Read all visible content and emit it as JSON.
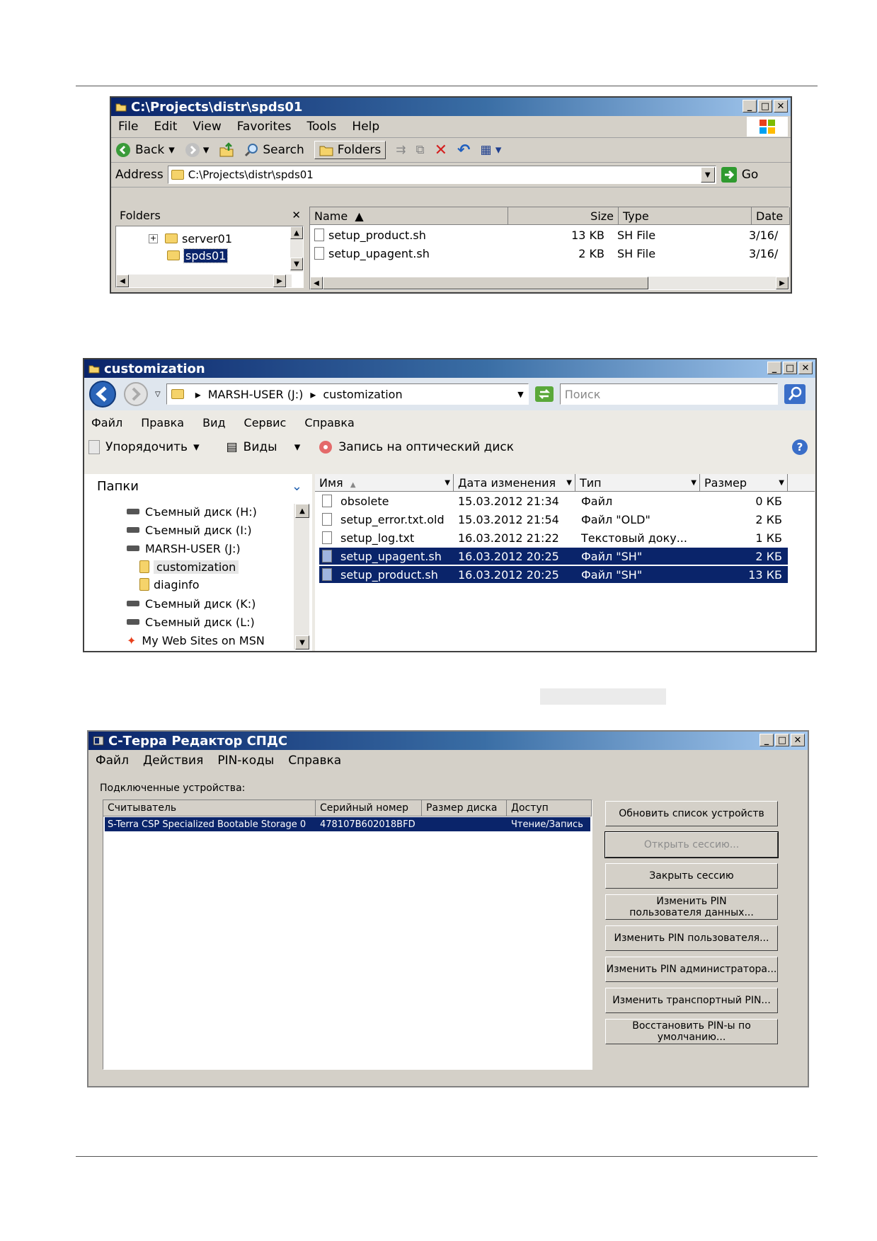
{
  "xp_explorer": {
    "title": "C:\\Projects\\distr\\spds01",
    "menu": [
      "File",
      "Edit",
      "View",
      "Favorites",
      "Tools",
      "Help"
    ],
    "toolbar": {
      "back": "Back",
      "search": "Search",
      "folders": "Folders"
    },
    "address_label": "Address",
    "address_value": "C:\\Projects\\distr\\spds01",
    "go_label": "Go",
    "folders_pane_title": "Folders",
    "tree": [
      {
        "label": "server01",
        "expander": "+"
      },
      {
        "label": "spds01",
        "expander": ""
      }
    ],
    "columns": [
      "Name",
      "Size",
      "Type",
      "Date"
    ],
    "files": [
      {
        "name": "setup_product.sh",
        "size": "13 KB",
        "type": "SH File",
        "date": "3/16/"
      },
      {
        "name": "setup_upagent.sh",
        "size": "2 KB",
        "type": "SH File",
        "date": "3/16/"
      }
    ]
  },
  "vista_explorer": {
    "title": "customization",
    "breadcrumb": [
      "MARSH-USER (J:)",
      "customization"
    ],
    "search_placeholder": "Поиск",
    "menu": [
      "Файл",
      "Правка",
      "Вид",
      "Сервис",
      "Справка"
    ],
    "toolbar": {
      "organize": "Упорядочить",
      "views": "Виды",
      "burn": "Запись на оптический диск"
    },
    "folders_title": "Папки",
    "tree": [
      {
        "label": "Съемный диск (H:)",
        "kind": "drive"
      },
      {
        "label": "Съемный диск (I:)",
        "kind": "drive"
      },
      {
        "label": "MARSH-USER (J:)",
        "kind": "drive"
      },
      {
        "label": "customization",
        "kind": "folder"
      },
      {
        "label": "diaginfo",
        "kind": "folder"
      },
      {
        "label": "Съемный диск (K:)",
        "kind": "drive"
      },
      {
        "label": "Съемный диск (L:)",
        "kind": "drive"
      },
      {
        "label": "My Web Sites on MSN",
        "kind": "web"
      }
    ],
    "columns": [
      "Имя",
      "Дата изменения",
      "Тип",
      "Размер"
    ],
    "files": [
      {
        "name": "obsolete",
        "date": "15.03.2012 21:34",
        "type": "Файл",
        "size": "0 КБ",
        "selected": false
      },
      {
        "name": "setup_error.txt.old",
        "date": "15.03.2012 21:54",
        "type": "Файл \"OLD\"",
        "size": "2 КБ",
        "selected": false
      },
      {
        "name": "setup_log.txt",
        "date": "16.03.2012 21:22",
        "type": "Текстовый доку...",
        "size": "1 КБ",
        "selected": false
      },
      {
        "name": "setup_upagent.sh",
        "date": "16.03.2012 20:25",
        "type": "Файл \"SH\"",
        "size": "2 КБ",
        "selected": true
      },
      {
        "name": "setup_product.sh",
        "date": "16.03.2012 20:25",
        "type": "Файл \"SH\"",
        "size": "13 КБ",
        "selected": true
      }
    ]
  },
  "sterra_editor": {
    "title": "С-Терра Редактор СПДС",
    "menu": [
      "Файл",
      "Действия",
      "PIN-коды",
      "Справка"
    ],
    "devices_label": "Подключенные устройства:",
    "columns": [
      "Считыватель",
      "Серийный номер",
      "Размер диска",
      "Доступ"
    ],
    "devices": [
      {
        "reader": "S-Terra CSP Specialized Bootable Storage 0",
        "serial": "478107B602018BFD",
        "size": "",
        "access": "Чтение/Запись"
      }
    ],
    "buttons": [
      {
        "label": "Обновить список устройств",
        "enabled": true
      },
      {
        "label": "Открыть сессию...",
        "enabled": false
      },
      {
        "label": "Закрыть сессию",
        "enabled": true
      },
      {
        "label": "Изменить PIN пользователя данных...",
        "enabled": true
      },
      {
        "label": "Изменить PIN пользователя...",
        "enabled": true
      },
      {
        "label": "Изменить PIN администратора...",
        "enabled": true
      },
      {
        "label": "Изменить транспортный PIN...",
        "enabled": true
      },
      {
        "label": "Восстановить PIN-ы по умолчанию...",
        "enabled": true
      }
    ]
  },
  "colors": {
    "selection": "#0a246a",
    "titlebar_start": "#0a246a",
    "titlebar_end": "#a6caf0",
    "window_face": "#d4d0c8"
  }
}
